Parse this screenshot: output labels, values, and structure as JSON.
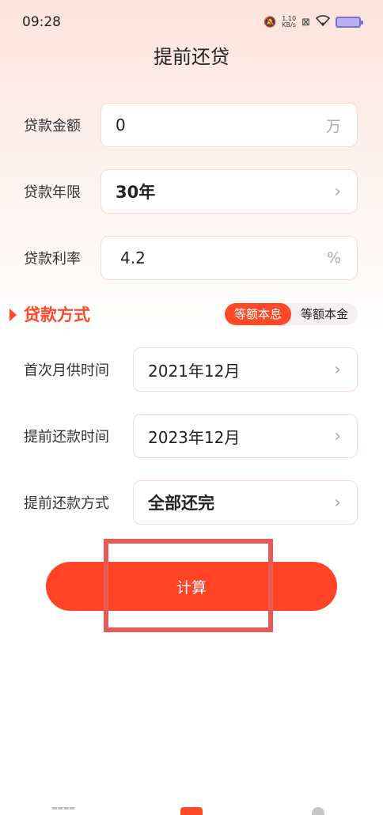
{
  "status_bar": {
    "time": "09:28",
    "net_speed_value": "1.10",
    "net_speed_unit": "KB/s",
    "mute_icon": "bell-off-icon",
    "wifi_icon": "wifi-icon"
  },
  "header": {
    "title": "提前还贷"
  },
  "form": {
    "amount": {
      "label": "贷款金额",
      "value": "0",
      "unit": "万"
    },
    "term": {
      "label": "贷款年限",
      "value": "30年"
    },
    "rate": {
      "label": "贷款利率",
      "value": "4.2",
      "unit": "%"
    },
    "method": {
      "label": "贷款方式",
      "options": [
        "等额本息",
        "等额本金"
      ],
      "selected": "等额本息"
    },
    "first_payment": {
      "label": "首次月供时间",
      "value": "2021年12月"
    },
    "prepay_time": {
      "label": "提前还款时间",
      "value": "2023年12月"
    },
    "prepay_method": {
      "label": "提前还款方式",
      "value": "全部还完"
    }
  },
  "actions": {
    "calculate_label": "计算"
  },
  "colors": {
    "accent": "#ff4a2a",
    "button": "#ff4324",
    "highlight": "#e85a55"
  }
}
